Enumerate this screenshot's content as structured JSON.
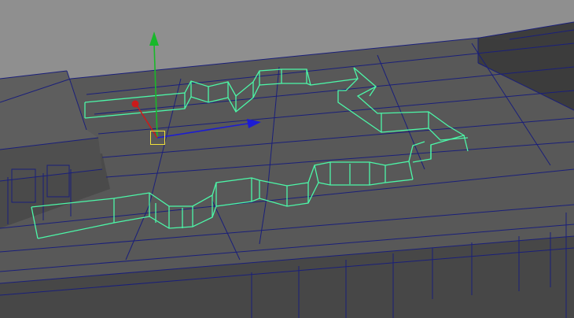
{
  "viewport": {
    "colors": {
      "background": "#8f8f8f",
      "roof": "#585858",
      "wireframe": "#1a1f7a",
      "selection": "#4cf7a8",
      "axis_x": "#1c1cd4",
      "axis_y": "#18b82a",
      "axis_z": "#cc1a1a",
      "manipulator_center": "#f2e23a"
    },
    "manipulator": {
      "type": "move-tool",
      "axes": [
        "x",
        "y",
        "z"
      ]
    },
    "selection": {
      "type": "parapet-wall",
      "state": "selected"
    }
  }
}
